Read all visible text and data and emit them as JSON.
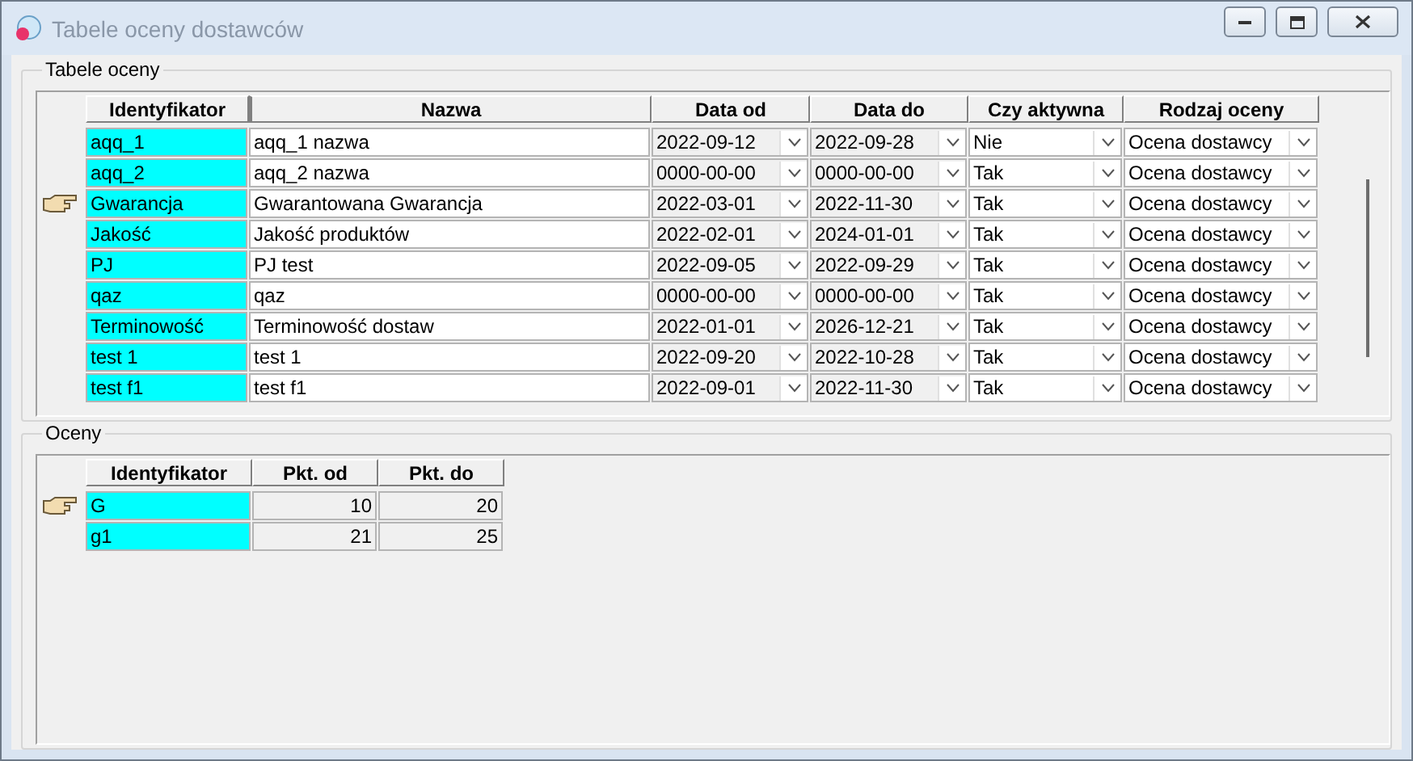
{
  "window": {
    "title": "Tabele oceny dostawców"
  },
  "tables_group": {
    "title": "Tabele oceny",
    "columns": [
      "Identyfikator",
      "Nazwa",
      "Data od",
      "Data do",
      "Czy aktywna",
      "Rodzaj oceny"
    ],
    "rows": [
      {
        "id": "aqq_1",
        "name": "aqq_1 nazwa",
        "from": "2022-09-12",
        "to": "2022-09-28",
        "active": "Nie",
        "type": "Ocena dostawcy",
        "selected": false
      },
      {
        "id": "aqq_2",
        "name": "aqq_2 nazwa",
        "from": "0000-00-00",
        "to": "0000-00-00",
        "active": "Tak",
        "type": "Ocena dostawcy",
        "selected": false
      },
      {
        "id": "Gwarancja",
        "name": "Gwarantowana Gwarancja",
        "from": "2022-03-01",
        "to": "2022-11-30",
        "active": "Tak",
        "type": "Ocena dostawcy",
        "selected": true
      },
      {
        "id": "Jakość",
        "name": "Jakość produktów",
        "from": "2022-02-01",
        "to": "2024-01-01",
        "active": "Tak",
        "type": "Ocena dostawcy",
        "selected": false
      },
      {
        "id": "PJ",
        "name": "PJ test",
        "from": "2022-09-05",
        "to": "2022-09-29",
        "active": "Tak",
        "type": "Ocena dostawcy",
        "selected": false
      },
      {
        "id": "qaz",
        "name": "qaz",
        "from": "0000-00-00",
        "to": "0000-00-00",
        "active": "Tak",
        "type": "Ocena dostawcy",
        "selected": false
      },
      {
        "id": "Terminowość",
        "name": "Terminowość dostaw",
        "from": "2022-01-01",
        "to": "2026-12-21",
        "active": "Tak",
        "type": "Ocena dostawcy",
        "selected": false
      },
      {
        "id": "test 1",
        "name": "test 1",
        "from": "2022-09-20",
        "to": "2022-10-28",
        "active": "Tak",
        "type": "Ocena dostawcy",
        "selected": false
      },
      {
        "id": "test f1",
        "name": "test f1",
        "from": "2022-09-01",
        "to": "2022-11-30",
        "active": "Tak",
        "type": "Ocena dostawcy",
        "selected": false
      }
    ]
  },
  "grades_group": {
    "title": "Oceny",
    "columns": [
      "Identyfikator",
      "Pkt. od",
      "Pkt. do"
    ],
    "rows": [
      {
        "id": "G",
        "from": "10",
        "to": "20",
        "selected": true
      },
      {
        "id": "g1",
        "from": "21",
        "to": "25",
        "selected": false
      }
    ]
  }
}
